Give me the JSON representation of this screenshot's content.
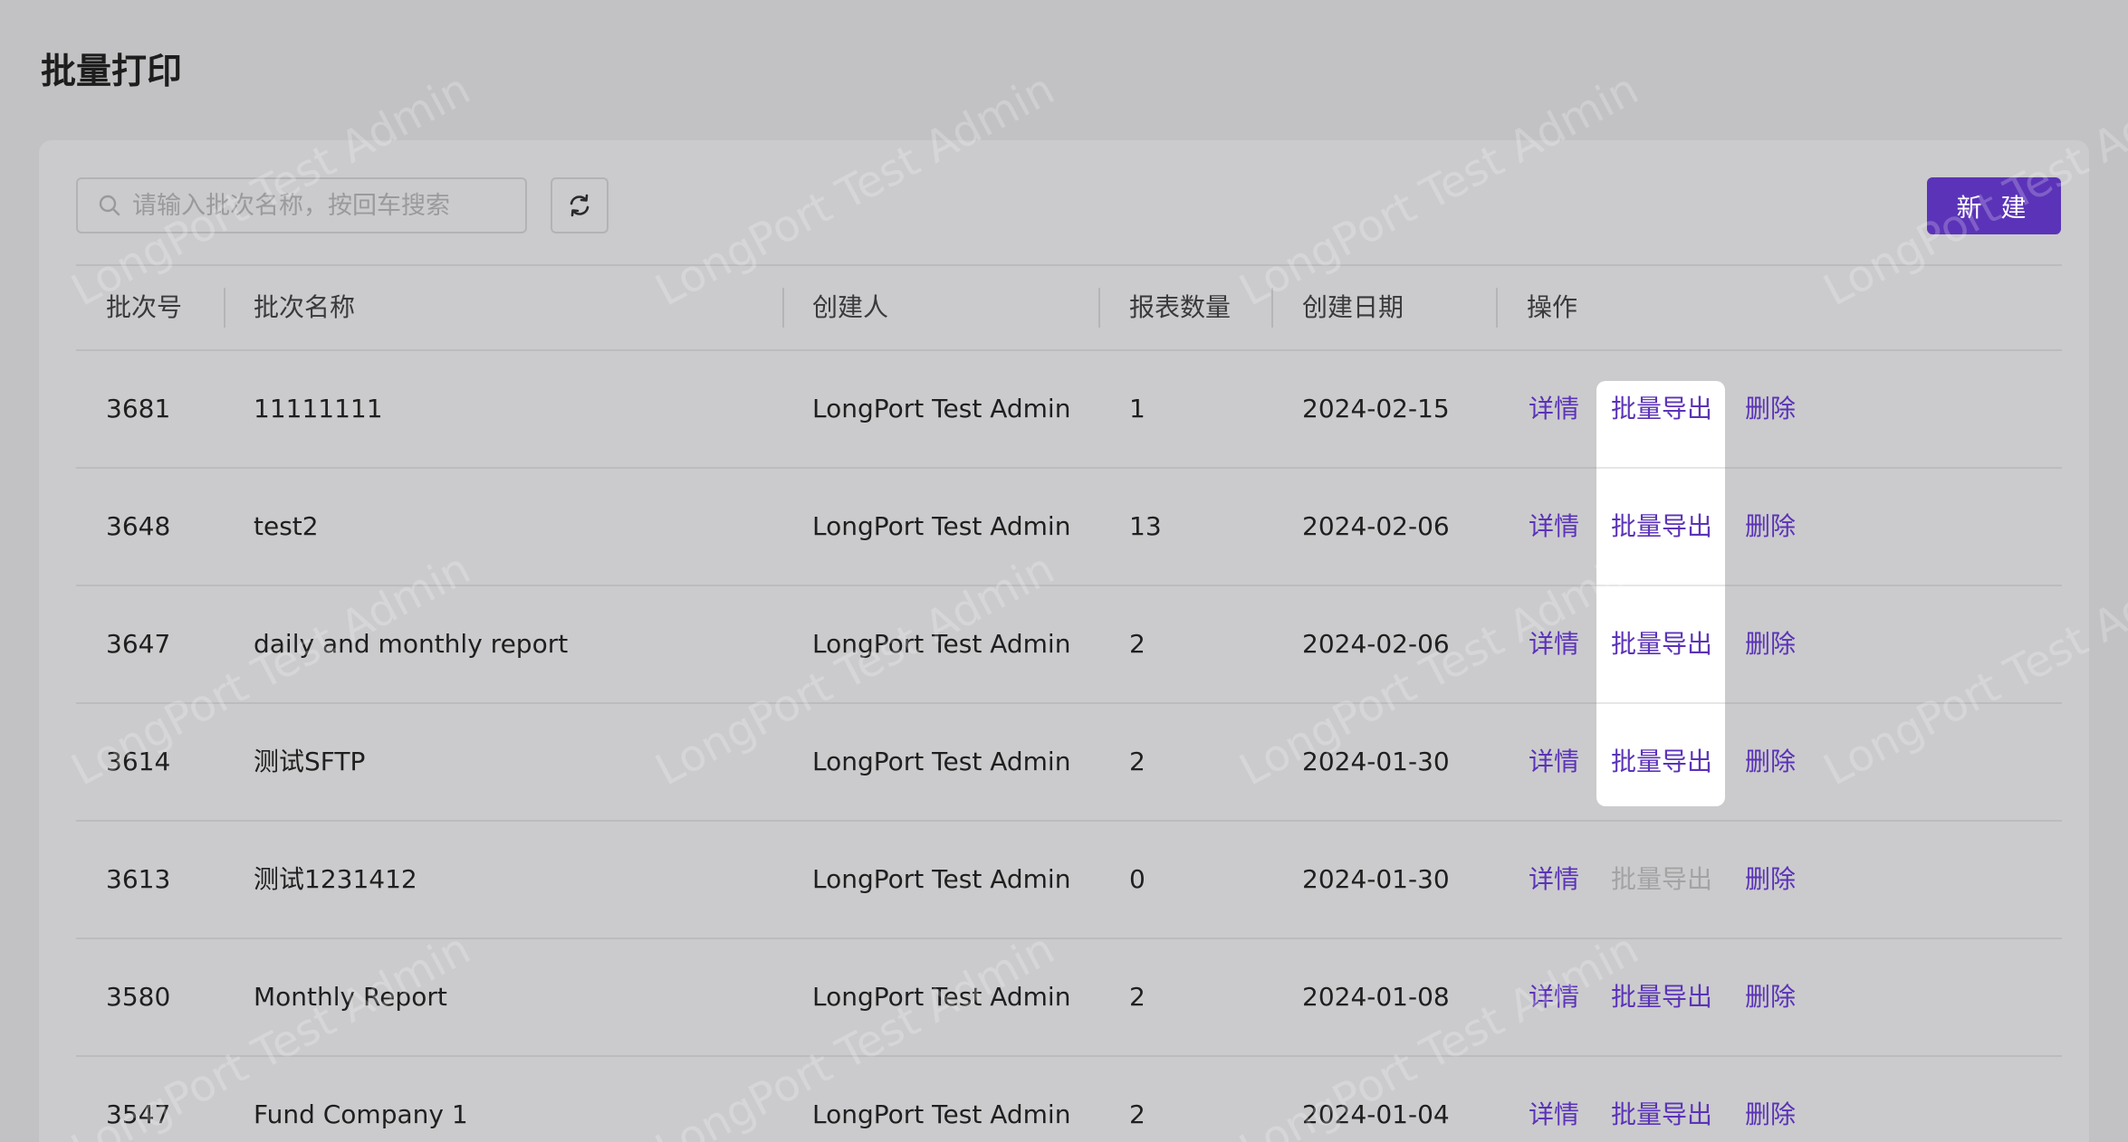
{
  "page": {
    "title": "批量打印"
  },
  "toolbar": {
    "search_placeholder": "请输入批次名称，按回车搜索",
    "search_value": "",
    "refresh_icon": "refresh-icon",
    "new_label": "新 建"
  },
  "table": {
    "columns": [
      "批次号",
      "批次名称",
      "创建人",
      "报表数量",
      "创建日期",
      "操作"
    ],
    "rows": [
      {
        "id": "3681",
        "name": "11111111",
        "creator": "LongPort Test Admin",
        "count": "1",
        "date": "2024-02-15",
        "detail": "详情",
        "export": "批量导出",
        "delete": "删除",
        "export_disabled": false
      },
      {
        "id": "3648",
        "name": "test2",
        "creator": "LongPort Test Admin",
        "count": "13",
        "date": "2024-02-06",
        "detail": "详情",
        "export": "批量导出",
        "delete": "删除",
        "export_disabled": false
      },
      {
        "id": "3647",
        "name": "daily and monthly report",
        "creator": "LongPort Test Admin",
        "count": "2",
        "date": "2024-02-06",
        "detail": "详情",
        "export": "批量导出",
        "delete": "删除",
        "export_disabled": false
      },
      {
        "id": "3614",
        "name": "测试SFTP",
        "creator": "LongPort Test Admin",
        "count": "2",
        "date": "2024-01-30",
        "detail": "详情",
        "export": "批量导出",
        "delete": "删除",
        "export_disabled": false
      },
      {
        "id": "3613",
        "name": "测试1231412",
        "creator": "LongPort Test Admin",
        "count": "0",
        "date": "2024-01-30",
        "detail": "详情",
        "export": "批量导出",
        "delete": "删除",
        "export_disabled": true
      },
      {
        "id": "3580",
        "name": "Monthly Report",
        "creator": "LongPort Test Admin",
        "count": "2",
        "date": "2024-01-08",
        "detail": "详情",
        "export": "批量导出",
        "delete": "删除",
        "export_disabled": false
      },
      {
        "id": "3547",
        "name": "Fund Company 1",
        "creator": "LongPort Test Admin",
        "count": "2",
        "date": "2024-01-04",
        "detail": "详情",
        "export": "批量导出",
        "delete": "删除",
        "export_disabled": false
      }
    ]
  },
  "watermark": {
    "text": "LongPort Test Admin"
  },
  "colors": {
    "accent": "#5b33b8",
    "disabled": "#a3a3a5",
    "overlay": "#c2c2c4",
    "highlight": "#ffffff"
  }
}
